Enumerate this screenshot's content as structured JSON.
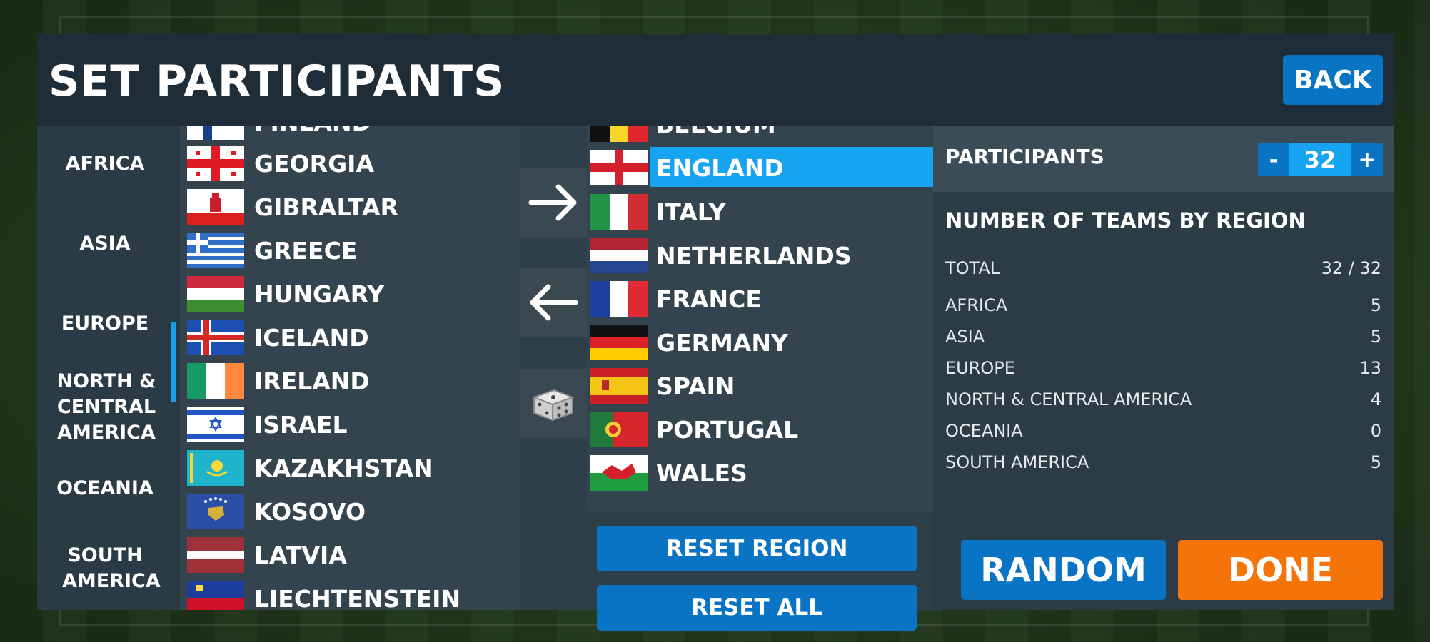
{
  "header": {
    "title": "SET PARTICIPANTS",
    "back_label": "BACK"
  },
  "regions": [
    {
      "label": "AFRICA"
    },
    {
      "label": "ASIA"
    },
    {
      "label": "EUROPE",
      "selected": true
    },
    {
      "label": "NORTH & CENTRAL AMERICA"
    },
    {
      "label": "OCEANIA"
    },
    {
      "label": "SOUTH AMERICA"
    }
  ],
  "available": [
    {
      "name": "FINLAND",
      "flag": "finland-flag"
    },
    {
      "name": "GEORGIA",
      "flag": "georgia-flag"
    },
    {
      "name": "GIBRALTAR",
      "flag": "gibraltar-flag"
    },
    {
      "name": "GREECE",
      "flag": "greece-flag"
    },
    {
      "name": "HUNGARY",
      "flag": "hungary-flag"
    },
    {
      "name": "ICELAND",
      "flag": "iceland-flag"
    },
    {
      "name": "IRELAND",
      "flag": "ireland-flag"
    },
    {
      "name": "ISRAEL",
      "flag": "israel-flag"
    },
    {
      "name": "KAZAKHSTAN",
      "flag": "kazakhstan-flag"
    },
    {
      "name": "KOSOVO",
      "flag": "kosovo-flag"
    },
    {
      "name": "LATVIA",
      "flag": "latvia-flag"
    },
    {
      "name": "LIECHTENSTEIN",
      "flag": "liechtenstein-flag"
    }
  ],
  "controls": {
    "add_icon": "arrow-right-icon",
    "remove_icon": "arrow-left-icon",
    "random_icon": "dice-icon"
  },
  "selected": [
    {
      "name": "BELGIUM",
      "flag": "belgium-flag"
    },
    {
      "name": "ENGLAND",
      "flag": "england-flag",
      "highlighted": true
    },
    {
      "name": "ITALY",
      "flag": "italy-flag"
    },
    {
      "name": "NETHERLANDS",
      "flag": "netherlands-flag"
    },
    {
      "name": "FRANCE",
      "flag": "france-flag"
    },
    {
      "name": "GERMANY",
      "flag": "germany-flag"
    },
    {
      "name": "SPAIN",
      "flag": "spain-flag"
    },
    {
      "name": "PORTUGAL",
      "flag": "portugal-flag"
    },
    {
      "name": "WALES",
      "flag": "wales-flag"
    }
  ],
  "selected_actions": {
    "reset_region": "RESET REGION",
    "reset_all": "RESET ALL"
  },
  "participants": {
    "label": "PARTICIPANTS",
    "minus": "-",
    "value": "32",
    "plus": "+"
  },
  "teams_by_region": {
    "title": "NUMBER OF TEAMS BY REGION",
    "rows": [
      {
        "label": "TOTAL",
        "value": "32 / 32"
      },
      {
        "label": "AFRICA",
        "value": "5"
      },
      {
        "label": "ASIA",
        "value": "5"
      },
      {
        "label": "EUROPE",
        "value": "13"
      },
      {
        "label": "NORTH & CENTRAL AMERICA",
        "value": "4"
      },
      {
        "label": "OCEANIA",
        "value": "0"
      },
      {
        "label": "SOUTH AMERICA",
        "value": "5"
      }
    ]
  },
  "footer": {
    "random_label": "RANDOM",
    "done_label": "DONE"
  },
  "colors": {
    "accent": "#16a3f0",
    "button_blue": "#0a74c4",
    "done_orange": "#f57409",
    "panel": "#2a3a45"
  }
}
